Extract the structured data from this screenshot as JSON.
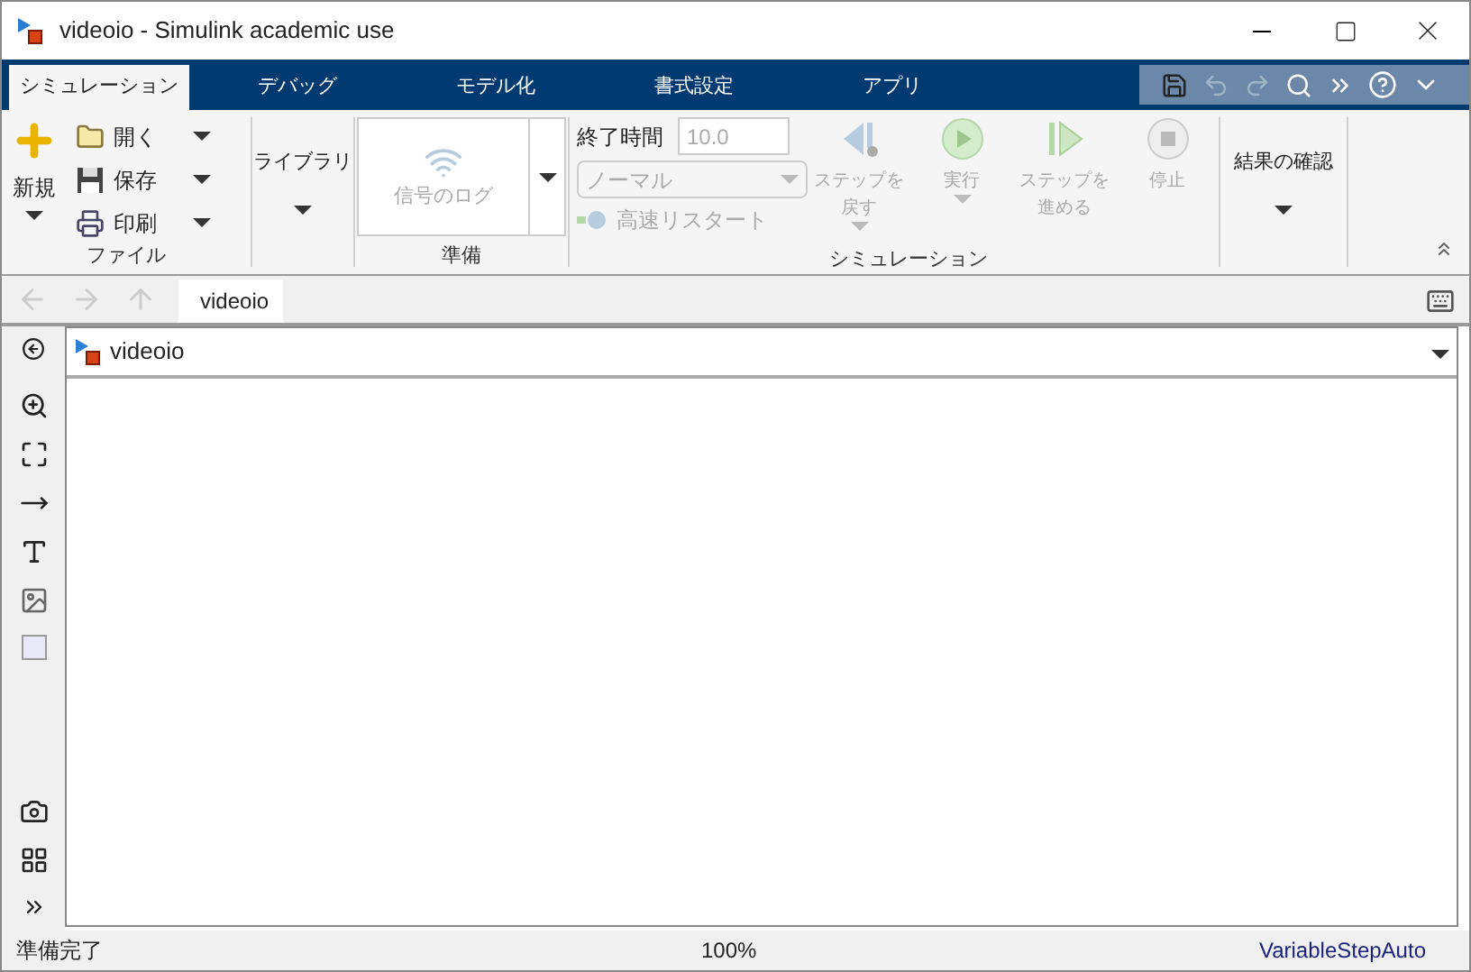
{
  "window": {
    "title": "videoio - Simulink academic use"
  },
  "tabs": [
    {
      "label": "シミュレーション",
      "selected": true
    },
    {
      "label": "デバッグ",
      "selected": false
    },
    {
      "label": "モデル化",
      "selected": false
    },
    {
      "label": "書式設定",
      "selected": false
    },
    {
      "label": "アプリ",
      "selected": false
    }
  ],
  "ribbon": {
    "file": {
      "new": "新規",
      "items": [
        {
          "kind": "open",
          "label": "開く"
        },
        {
          "kind": "save",
          "label": "保存"
        },
        {
          "kind": "print",
          "label": "印刷"
        }
      ],
      "label": "ファイル"
    },
    "library": "ライブラリ",
    "prepare": {
      "log": {
        "label": "信号のログ",
        "disabled": true
      },
      "label": "準備"
    },
    "simulation": {
      "stop_time_label": "終了時間",
      "stop_time": "10.0",
      "mode": "ノーマル",
      "fast_restart": {
        "label": "高速リスタート",
        "disabled": true
      },
      "buttons": [
        {
          "kind": "step-back",
          "lines": [
            "ステップを",
            "戻す"
          ],
          "menu": true,
          "disabled": true
        },
        {
          "kind": "run",
          "lines": [
            "実行"
          ],
          "menu": true,
          "disabled": true
        },
        {
          "kind": "step-forward",
          "lines": [
            "ステップを",
            "進める"
          ],
          "menu": false,
          "disabled": true
        },
        {
          "kind": "stop",
          "lines": [
            "停止"
          ],
          "menu": false,
          "disabled": true
        }
      ],
      "label": "シミュレーション"
    },
    "review": "結果の確認"
  },
  "nav": {
    "tab": "videoio"
  },
  "breadcrumb": "videoio",
  "status_bar": {
    "state": "準備完了",
    "zoom": "100%",
    "solver": "VariableStepAuto"
  }
}
